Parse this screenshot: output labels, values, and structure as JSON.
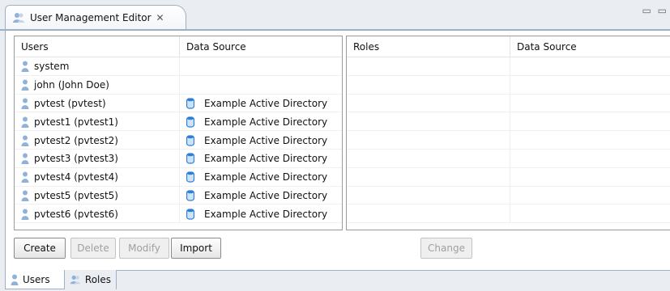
{
  "editor": {
    "tab_title": "User Management Editor",
    "close_glyph": "✕",
    "window_controls": "▭ ▭"
  },
  "users_table": {
    "columns": [
      "Users",
      "Data Source"
    ],
    "rows": [
      {
        "user": "system",
        "source": ""
      },
      {
        "user": "john (John Doe)",
        "source": ""
      },
      {
        "user": "pvtest (pvtest)",
        "source": "Example Active Directory"
      },
      {
        "user": "pvtest1 (pvtest1)",
        "source": "Example Active Directory"
      },
      {
        "user": "pvtest2 (pvtest2)",
        "source": "Example Active Directory"
      },
      {
        "user": "pvtest3 (pvtest3)",
        "source": "Example Active Directory"
      },
      {
        "user": "pvtest4 (pvtest4)",
        "source": "Example Active Directory"
      },
      {
        "user": "pvtest5 (pvtest5)",
        "source": "Example Active Directory"
      },
      {
        "user": "pvtest6 (pvtest6)",
        "source": "Example Active Directory"
      }
    ]
  },
  "roles_table": {
    "columns": [
      "Roles",
      "Data Source"
    ],
    "empty_rows": 9
  },
  "buttons": {
    "create": "Create",
    "delete": "Delete",
    "modify": "Modify",
    "import": "Import",
    "change": "Change"
  },
  "bottom_tabs": {
    "users": "Users",
    "roles": "Roles"
  },
  "icons": {
    "user": "user-icon",
    "datasource": "database-icon",
    "roles": "roles-icon"
  },
  "colors": {
    "user_icon": "#8fb2d9",
    "db_icon": "#2d7fd6",
    "border": "#9eb0c5"
  }
}
